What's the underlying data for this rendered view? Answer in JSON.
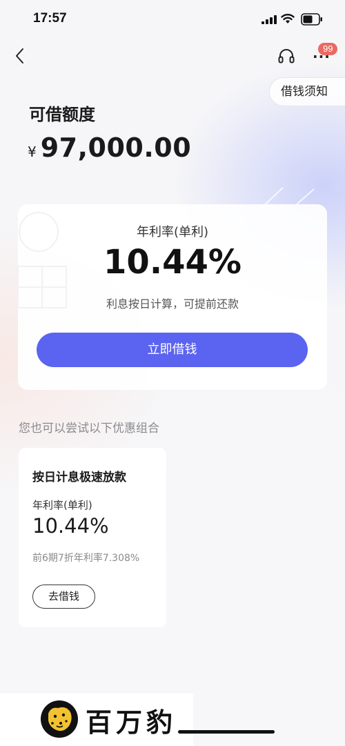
{
  "status_bar": {
    "time": "17:57"
  },
  "nav": {
    "back_icon": "chevron-left-icon",
    "service_icon": "headset-icon",
    "more_label": "···",
    "more_badge": "99",
    "notice_label": "借钱须知"
  },
  "header": {
    "title": "可借额度",
    "currency": "¥",
    "amount": "97,000.00"
  },
  "rate_card": {
    "rate_label": "年利率(单利)",
    "rate_value": "10.44%",
    "note": "利息按日计算，可提前还款",
    "button_label": "立即借钱"
  },
  "offers": {
    "heading": "您也可以尝试以下优惠组合",
    "items": [
      {
        "title": "按日计息极速放款",
        "rate_label": "年利率(单利)",
        "rate_value": "10.44%",
        "note": "前6期7折年利率7.308%",
        "button_label": "去借钱"
      }
    ]
  },
  "watermark": {
    "brand": "百万豹"
  },
  "colors": {
    "primary_button": "#5b63f1",
    "badge": "#ea6a62",
    "muted_text": "#8a8a8e"
  }
}
